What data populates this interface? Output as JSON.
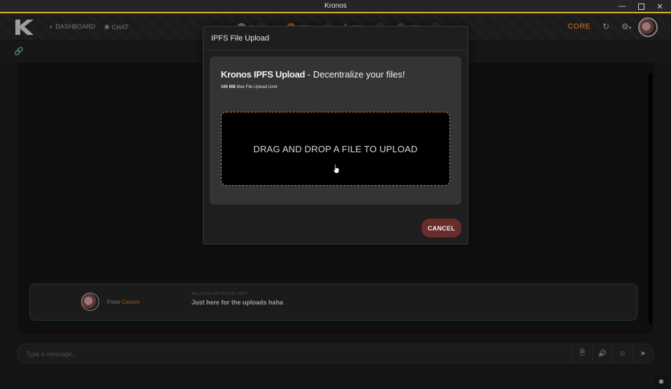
{
  "window": {
    "title": "Kronos"
  },
  "nav": {
    "dashboard": "DASHBOARD",
    "chat": "CHAT",
    "core": "CORE"
  },
  "tickers": [
    {
      "symbol": "B",
      "color": "#bfbfbf"
    },
    {
      "symbol": "BTC",
      "color": "#e08a2a"
    },
    {
      "symbol": "ETH",
      "color": "#7a86c9"
    },
    {
      "symbol": "ARK",
      "color": "#8b3fb0"
    }
  ],
  "colors": {
    "accent": "#d9b02a",
    "core": "#e08a2a",
    "cancel": "#6a2b2b",
    "dropzone_border": "#c98d2a"
  },
  "modal": {
    "title": "IPFS File Upload",
    "heading_bold": "Kronos IPFS Upload",
    "heading_rest": " - Decentralize your files!",
    "limit_bold": "100 MB",
    "limit_rest": " Max File Upload Limit",
    "dropzone": "DRAG AND DROP A FILE TO UPLOAD",
    "cancel": "CANCEL"
  },
  "message": {
    "from_label": "From ",
    "from_name": "Carsen",
    "meta": "Wed, 23 Dec 2020 05:50:35 • SENT",
    "text": "Just here for the uploads haha"
  },
  "composer": {
    "placeholder": "Type a message..."
  }
}
